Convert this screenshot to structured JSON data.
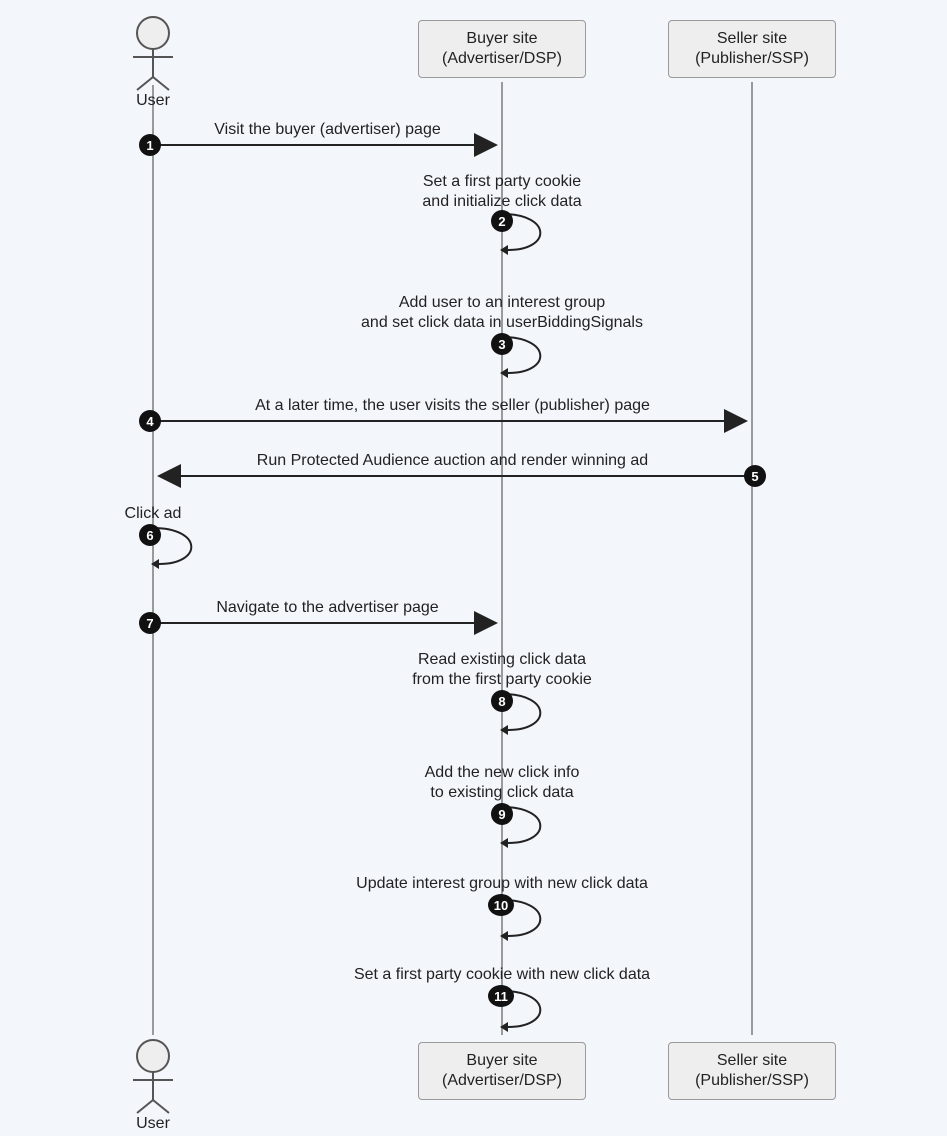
{
  "participants": {
    "user": {
      "label": "User"
    },
    "buyer": {
      "line1": "Buyer site",
      "line2": "(Advertiser/DSP)"
    },
    "seller": {
      "line1": "Seller site",
      "line2": "(Publisher/SSP)"
    }
  },
  "steps": {
    "s1": {
      "num": "1",
      "label": "Visit the buyer (advertiser) page"
    },
    "s2": {
      "num": "2",
      "label": "Set a first party cookie\nand initialize click data"
    },
    "s3": {
      "num": "3",
      "label": "Add user to an interest group\nand set click data in userBiddingSignals"
    },
    "s4": {
      "num": "4",
      "label": "At a later time, the user visits the seller (publisher) page"
    },
    "s5": {
      "num": "5",
      "label": "Run Protected Audience auction and render winning ad"
    },
    "s6": {
      "num": "6",
      "label": "Click ad"
    },
    "s7": {
      "num": "7",
      "label": "Navigate to the advertiser page"
    },
    "s8": {
      "num": "8",
      "label": "Read existing click data\nfrom the first party cookie"
    },
    "s9": {
      "num": "9",
      "label": "Add the new click info\nto existing click data"
    },
    "s10": {
      "num": "10",
      "label": "Update interest group with new click data"
    },
    "s11": {
      "num": "11",
      "label": "Set a first party cookie with new click data"
    }
  },
  "chart_data": {
    "type": "sequence-diagram",
    "participants": [
      {
        "id": "user",
        "display": "User",
        "kind": "actor"
      },
      {
        "id": "buyer",
        "display": "Buyer site (Advertiser/DSP)",
        "kind": "object"
      },
      {
        "id": "seller",
        "display": "Seller site (Publisher/SSP)",
        "kind": "object"
      }
    ],
    "messages": [
      {
        "n": 1,
        "from": "user",
        "to": "buyer",
        "text": "Visit the buyer (advertiser) page"
      },
      {
        "n": 2,
        "from": "buyer",
        "to": "buyer",
        "text": "Set a first party cookie and initialize click data"
      },
      {
        "n": 3,
        "from": "buyer",
        "to": "buyer",
        "text": "Add user to an interest group and set click data in userBiddingSignals"
      },
      {
        "n": 4,
        "from": "user",
        "to": "seller",
        "text": "At a later time, the user visits the seller (publisher) page"
      },
      {
        "n": 5,
        "from": "seller",
        "to": "user",
        "text": "Run Protected Audience auction and render winning ad"
      },
      {
        "n": 6,
        "from": "user",
        "to": "user",
        "text": "Click ad"
      },
      {
        "n": 7,
        "from": "user",
        "to": "buyer",
        "text": "Navigate to the advertiser page"
      },
      {
        "n": 8,
        "from": "buyer",
        "to": "buyer",
        "text": "Read existing click data from the first party cookie"
      },
      {
        "n": 9,
        "from": "buyer",
        "to": "buyer",
        "text": "Add the new click info to existing click data"
      },
      {
        "n": 10,
        "from": "buyer",
        "to": "buyer",
        "text": "Update interest group with new click data"
      },
      {
        "n": 11,
        "from": "buyer",
        "to": "buyer",
        "text": "Set a first party cookie with new click data"
      }
    ]
  }
}
